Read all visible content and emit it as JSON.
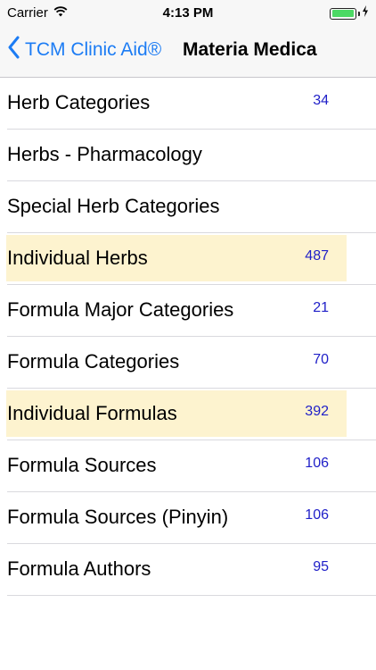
{
  "status_bar": {
    "carrier": "Carrier",
    "time": "4:13 PM",
    "battery_color": "#4cd964"
  },
  "nav": {
    "back_label": "TCM Clinic Aid®",
    "title": "Materia Medica",
    "accent": "#1c7cf4"
  },
  "list": {
    "highlight_color": "#fdf3cf",
    "count_color": "#2020c8",
    "items": [
      {
        "label": "Herb Categories",
        "count": "34"
      },
      {
        "label": "Herbs - Pharmacology",
        "count": ""
      },
      {
        "label": "Special Herb Categories",
        "count": ""
      },
      {
        "label": "Individual Herbs",
        "count": "487",
        "highlighted": true
      },
      {
        "label": "Formula Major Categories",
        "count": "21"
      },
      {
        "label": "Formula Categories",
        "count": "70"
      },
      {
        "label": "Individual Formulas",
        "count": "392",
        "highlighted": true
      },
      {
        "label": "Formula Sources",
        "count": "106"
      },
      {
        "label": "Formula Sources (Pinyin)",
        "count": "106"
      },
      {
        "label": "Formula Authors",
        "count": "95"
      }
    ]
  }
}
